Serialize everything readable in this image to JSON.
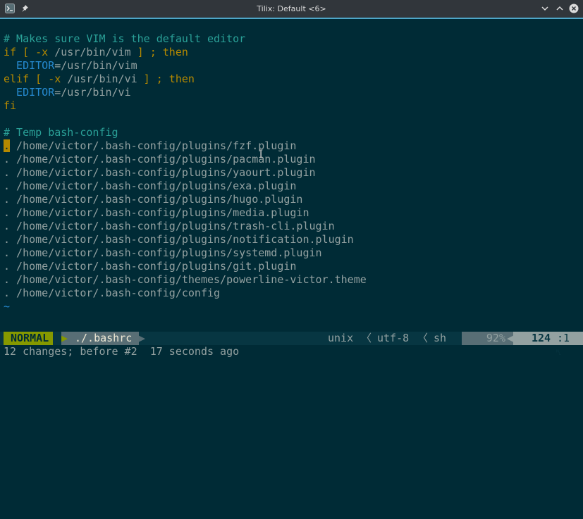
{
  "window": {
    "title": "Tilix: Default <6>"
  },
  "colors": {
    "background": "#002b36",
    "comment": "#2aa198",
    "keyword": "#b58900",
    "variable": "#268bd2",
    "text": "#93a1a1",
    "mode_bg": "#859900",
    "accent": "#4ea6c8"
  },
  "editor": {
    "lines": [
      {
        "segments": [
          {
            "t": "# Makes sure VIM is the default editor",
            "c": "cmt"
          }
        ]
      },
      {
        "segments": [
          {
            "t": "if [ -x ",
            "c": "kw"
          },
          {
            "t": "/usr/bin/vim",
            "c": "path"
          },
          {
            "t": " ] ; then",
            "c": "kw"
          }
        ]
      },
      {
        "segments": [
          {
            "t": "  EDITOR",
            "c": "var"
          },
          {
            "t": "=/usr/bin/vim",
            "c": "path"
          }
        ]
      },
      {
        "segments": [
          {
            "t": "elif [ -x ",
            "c": "kw"
          },
          {
            "t": "/usr/bin/vi",
            "c": "path"
          },
          {
            "t": " ] ; then",
            "c": "kw"
          }
        ]
      },
      {
        "segments": [
          {
            "t": "  EDITOR",
            "c": "var"
          },
          {
            "t": "=/usr/bin/vi",
            "c": "path"
          }
        ]
      },
      {
        "segments": [
          {
            "t": "fi",
            "c": "kw"
          }
        ]
      },
      {
        "segments": []
      },
      {
        "segments": [
          {
            "t": "# Temp bash-config",
            "c": "cmt"
          }
        ]
      },
      {
        "segments": [
          {
            "t": ".",
            "c": "cursor"
          },
          {
            "t": " /home/victor/.bash-config/plugins/fzf.plugin",
            "c": "path"
          }
        ]
      },
      {
        "segments": [
          {
            "t": ". /home/victor/.bash-config/plugins/pacman.plugin",
            "c": "path"
          }
        ]
      },
      {
        "segments": [
          {
            "t": ". /home/victor/.bash-config/plugins/yaourt.plugin",
            "c": "path"
          }
        ]
      },
      {
        "segments": [
          {
            "t": ". /home/victor/.bash-config/plugins/exa.plugin",
            "c": "path"
          }
        ]
      },
      {
        "segments": [
          {
            "t": ". /home/victor/.bash-config/plugins/hugo.plugin",
            "c": "path"
          }
        ]
      },
      {
        "segments": [
          {
            "t": ". /home/victor/.bash-config/plugins/media.plugin",
            "c": "path"
          }
        ]
      },
      {
        "segments": [
          {
            "t": ". /home/victor/.bash-config/plugins/trash-cli.plugin",
            "c": "path"
          }
        ]
      },
      {
        "segments": [
          {
            "t": ". /home/victor/.bash-config/plugins/notification.plugin",
            "c": "path"
          }
        ]
      },
      {
        "segments": [
          {
            "t": ". /home/victor/.bash-config/plugins/systemd.plugin",
            "c": "path"
          }
        ]
      },
      {
        "segments": [
          {
            "t": ". /home/victor/.bash-config/plugins/git.plugin",
            "c": "path"
          }
        ]
      },
      {
        "segments": [
          {
            "t": ". /home/victor/.bash-config/themes/powerline-victor.theme",
            "c": "path"
          }
        ]
      },
      {
        "segments": [
          {
            "t": ". /home/victor/.bash-config/config",
            "c": "path"
          }
        ]
      },
      {
        "segments": [
          {
            "t": "~",
            "c": "tilde"
          }
        ]
      }
    ]
  },
  "statusline": {
    "mode": "NORMAL",
    "file": "./.bashrc",
    "fileformat": "unix",
    "encoding": "utf-8",
    "filetype": "sh",
    "percent": "92%",
    "line_icon": "␤",
    "position": "124",
    "column": "1"
  },
  "message": "12 changes; before #2  17 seconds ago"
}
